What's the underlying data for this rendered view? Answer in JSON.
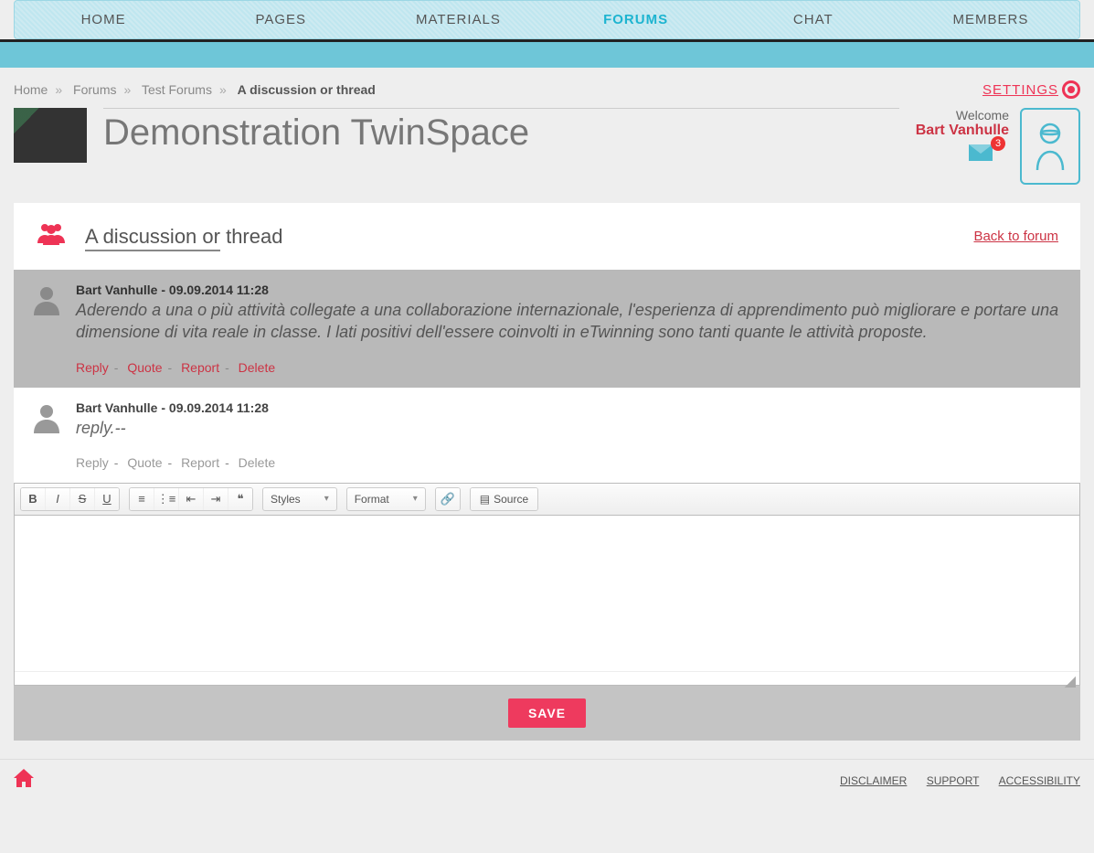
{
  "nav": {
    "items": [
      "HOME",
      "PAGES",
      "MATERIALS",
      "FORUMS",
      "CHAT",
      "MEMBERS"
    ],
    "active": "FORUMS"
  },
  "breadcrumb": {
    "items": [
      "Home",
      "Forums",
      "Test Forums"
    ],
    "current": "A discussion or thread",
    "settings": "SETTINGS"
  },
  "page": {
    "title": "Demonstration TwinSpace"
  },
  "user": {
    "welcome": "Welcome",
    "name": "Bart Vanhulle",
    "mail_count": "3"
  },
  "thread": {
    "icon": "group",
    "title_underlined": "A discussion or",
    "title_rest": " thread",
    "back": "Back to forum"
  },
  "posts": [
    {
      "author": "Bart Vanhulle",
      "ts": "09.09.2014 11:28",
      "body": "Aderendo a una o più attività collegate a una collaborazione internazionale, l'esperienza di apprendimento può migliorare e portare una dimensione di vita reale in classe. I lati positivi dell'essere coinvolti in eTwinning sono tanti quante le attività proposte.",
      "highlight": true,
      "actions_enabled": true
    },
    {
      "author": "Bart Vanhulle",
      "ts": "09.09.2014 11:28",
      "body": "reply.--",
      "highlight": false,
      "actions_enabled": false
    }
  ],
  "post_actions": {
    "reply": "Reply",
    "quote": "Quote",
    "report": "Report",
    "delete": "Delete"
  },
  "editor": {
    "styles": "Styles",
    "format": "Format",
    "source": "Source"
  },
  "save": {
    "label": "SAVE"
  },
  "footer": {
    "links": [
      "DISCLAIMER",
      "SUPPORT",
      "ACCESSIBILITY"
    ]
  }
}
